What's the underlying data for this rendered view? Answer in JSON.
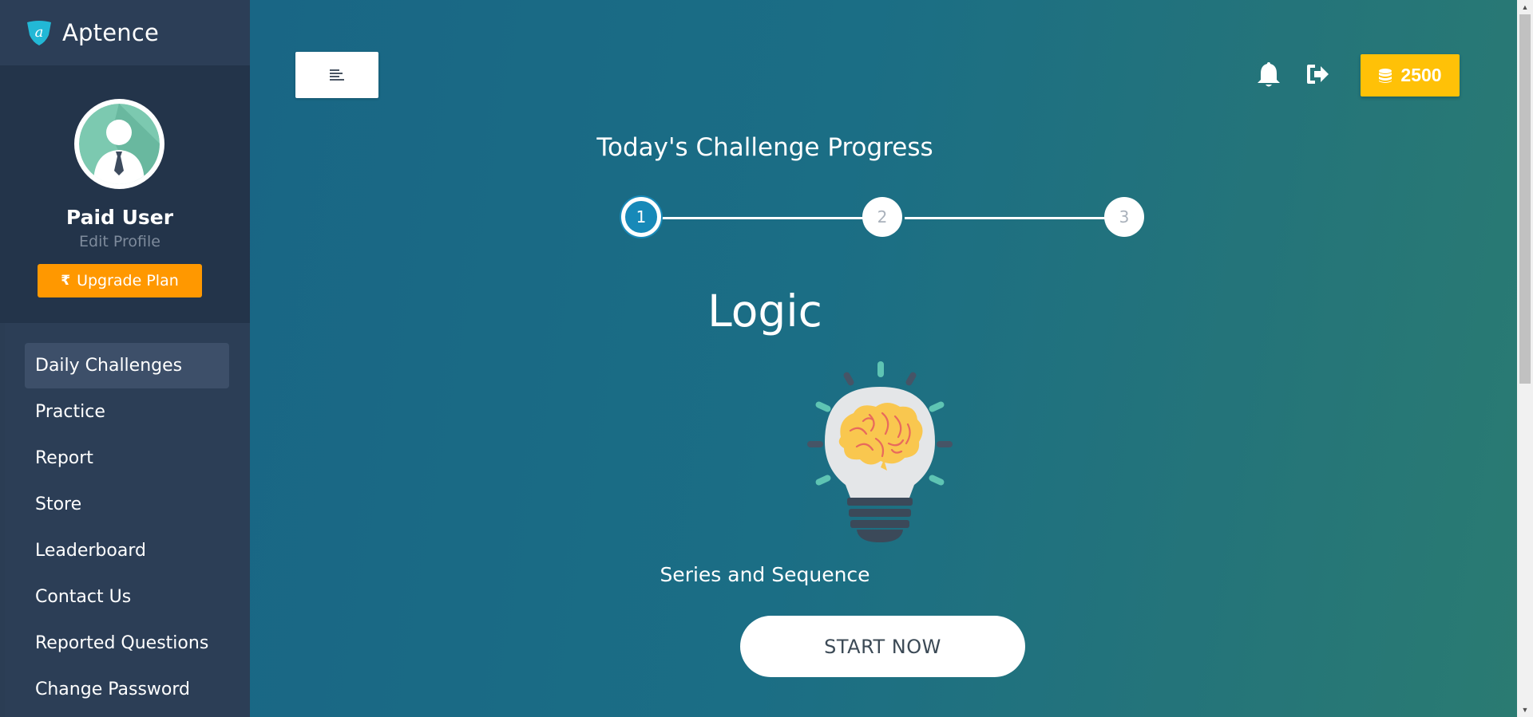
{
  "brand": {
    "name": "Aptence",
    "logo_letter": "a"
  },
  "profile": {
    "name": "Paid User",
    "edit_label": "Edit Profile",
    "upgrade_label": "Upgrade Plan",
    "upgrade_symbol": "₹"
  },
  "nav": {
    "items": [
      {
        "label": "Daily Challenges",
        "active": true
      },
      {
        "label": "Practice"
      },
      {
        "label": "Report"
      },
      {
        "label": "Store"
      },
      {
        "label": "Leaderboard"
      },
      {
        "label": "Contact Us"
      },
      {
        "label": "Reported Questions"
      },
      {
        "label": "Change Password"
      }
    ]
  },
  "header": {
    "coins": "2500"
  },
  "challenge": {
    "title": "Today's Challenge Progress",
    "steps": [
      "1",
      "2",
      "3"
    ],
    "current_step": 1,
    "topic": "Logic",
    "subtopic": "Series and Sequence",
    "start_label": "START NOW"
  },
  "colors": {
    "sidebar": "#2b3d54",
    "accent_orange": "#ff9800",
    "coins_yellow": "#ffc107",
    "step_active": "#1789b8"
  },
  "icons": {
    "menu": "menu-icon",
    "bell": "bell-icon",
    "logout": "logout-icon",
    "coins": "coins-icon",
    "rupee": "rupee-icon",
    "illustration": "lightbulb-brain-icon"
  }
}
